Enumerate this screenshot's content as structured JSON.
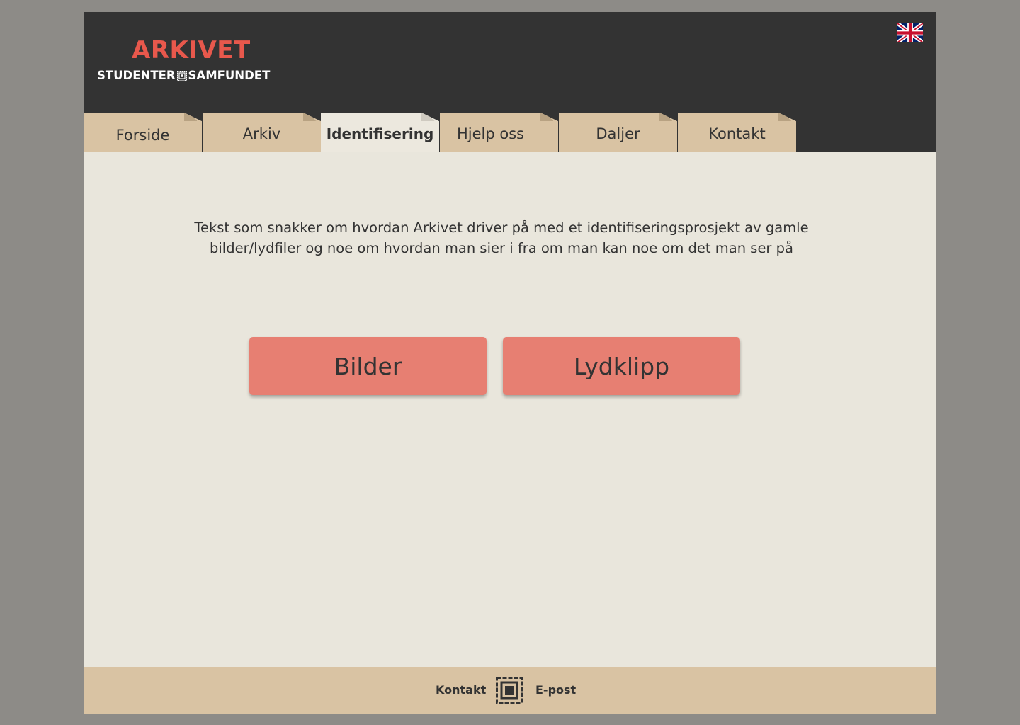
{
  "header": {
    "logo_title": "ARKIVET",
    "logo_sub_left": "STUDENTER",
    "logo_sub_right": "SAMFUNDET",
    "language_icon": "uk-flag-icon"
  },
  "tabs": [
    {
      "label": "Forside",
      "active": false
    },
    {
      "label": "Arkiv",
      "active": false
    },
    {
      "label": "Identifisering",
      "active": true
    },
    {
      "label": "Hjelp oss",
      "active": false
    },
    {
      "label": "Daljer",
      "active": false
    },
    {
      "label": "Kontakt",
      "active": false
    }
  ],
  "main": {
    "intro_text": "Tekst som snakker om hvordan Arkivet driver på med et identifiseringsprosjekt av gamle bilder/lydfiler og noe om hvordan man sier i fra om man kan noe om det man ser på",
    "buttons": [
      {
        "label": "Bilder"
      },
      {
        "label": "Lydklipp"
      }
    ]
  },
  "footer": {
    "contact_label": "Kontakt",
    "email_label": "E-post",
    "logo_icon": "samfundet-logo-icon"
  },
  "colors": {
    "header_bg": "#333333",
    "accent_red": "#e8584c",
    "button_bg": "#e77f72",
    "tab_bg": "#d9c3a3",
    "content_bg": "#e9e6dc",
    "page_bg": "#8d8b87"
  }
}
